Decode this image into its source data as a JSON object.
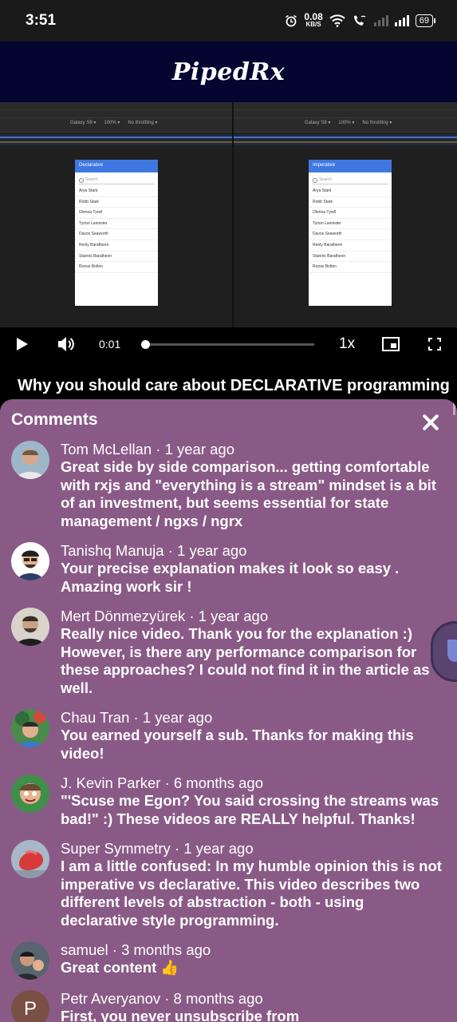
{
  "status_bar": {
    "time": "3:51",
    "net_speed_value": "0.08",
    "net_speed_unit": "KB/S",
    "battery": "69"
  },
  "header": {
    "brand": "PipedRx"
  },
  "video": {
    "left_panel_title": "Declarative",
    "right_panel_title": "Imperative",
    "search_placeholder": "Search",
    "device_label": "Galaxy S8 ▾",
    "zoom_label": "100% ▾",
    "throttle_label": "No throttling ▾",
    "names": [
      "Arya Stark",
      "Robb Stark",
      "Olenna Tyrell",
      "Tyrion Lannister",
      "Davos Seaworth",
      "Renly Baratheon",
      "Stannis Baratheon",
      "Roose Bolton"
    ]
  },
  "player": {
    "current_time": "0:01",
    "progress": 0.02,
    "playback_rate": "1x"
  },
  "video_title": "Why you should care about DECLARATIVE programming",
  "comments_panel": {
    "heading": "Comments",
    "items": [
      {
        "author_meta": "Tom McLellan · 1 year ago",
        "text": "Great side by side comparison... getting comfortable with rxjs and \"everything is a stream\" mindset is a bit of an investment, but seems essential for state management / ngxs / ngrx"
      },
      {
        "author_meta": "Tanishq Manuja · 1 year ago",
        "text": "Your precise explanation makes it look so easy . Amazing work sir !"
      },
      {
        "author_meta": "Mert Dönmezyürek · 1 year ago",
        "text": "Really nice video. Thank you for the explanation :) However, is there any performance comparison for these approaches? I could not find it in the article as well."
      },
      {
        "author_meta": "Chau Tran · 1 year ago",
        "text": "You earned yourself a sub. Thanks for making this video!"
      },
      {
        "author_meta": "J. Kevin Parker · 6 months ago",
        "text": "\"'Scuse me Egon? You said crossing the streams was bad!\" :) These videos are REALLY helpful. Thanks!"
      },
      {
        "author_meta": "Super Symmetry · 1 year ago",
        "text": "I am a little confused: In my humble opinion this is not imperative vs declarative. This video describes two different levels of abstraction - both - using declarative style programming."
      },
      {
        "author_meta": "samuel · 3 months ago",
        "text": "Great content 👍"
      },
      {
        "author_meta": "Petr Averyanov · 8 months ago",
        "text": "First, you never unsubscribe from",
        "avatar_letter": "P"
      }
    ]
  },
  "colors": {
    "header_bg": "#050531",
    "comments_bg": "#8a5a87",
    "panel_accent": "#3f78e0"
  }
}
